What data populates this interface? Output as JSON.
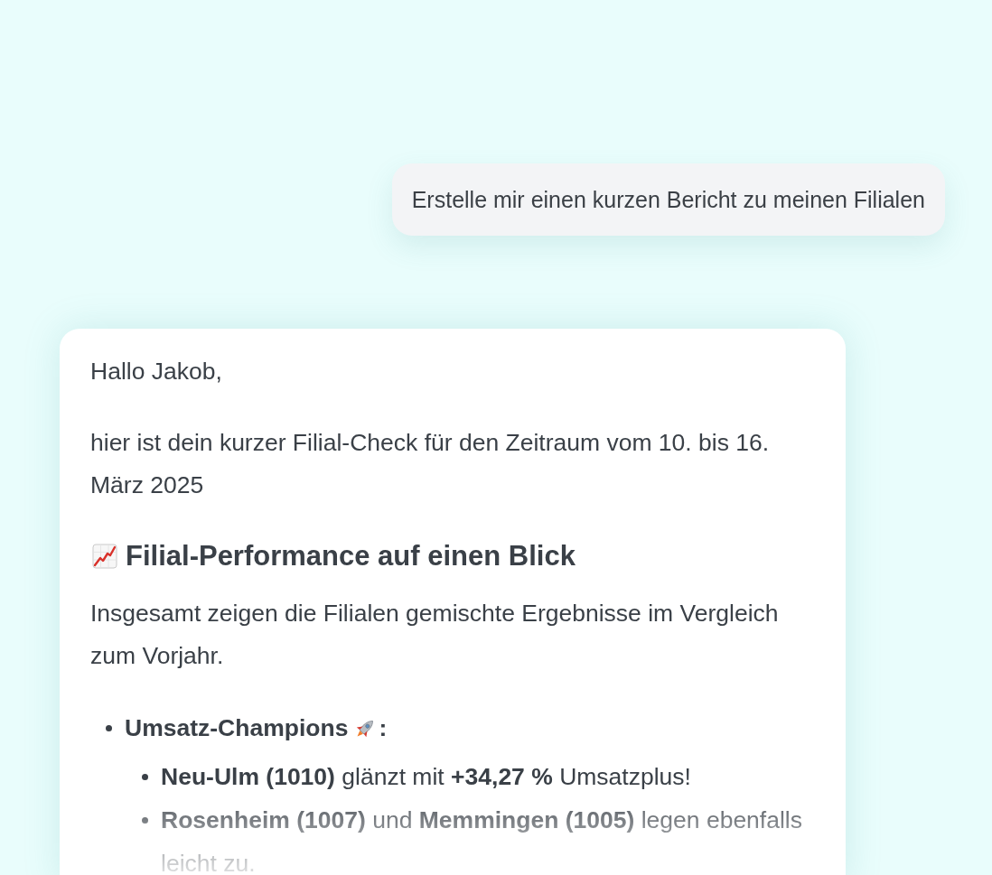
{
  "user_message": {
    "text": "Erstelle mir einen kurzen Bericht zu meinen Filialen"
  },
  "reply": {
    "greeting": "Hallo Jakob,",
    "intro": "hier ist dein kurzer Filial-Check für den Zeitraum vom 10. bis 16. März 2025",
    "section": {
      "heading": "Filial-Performance auf einen Blick",
      "summary": "Insgesamt zeigen die Filialen gemischte Ergebnisse im Vergleich zum Vorjahr.",
      "items": [
        {
          "label": "Umsatz-Champions",
          "label_end": ":",
          "children": [
            {
              "text": "**Neu-Ulm (1010)** glänzt mit **+34,27 %** Umsatzplus!"
            },
            {
              "text": "**Rosenheim (1007)** und **Memmingen (1005)** legen ebenfalls leicht zu."
            }
          ]
        }
      ]
    }
  }
}
